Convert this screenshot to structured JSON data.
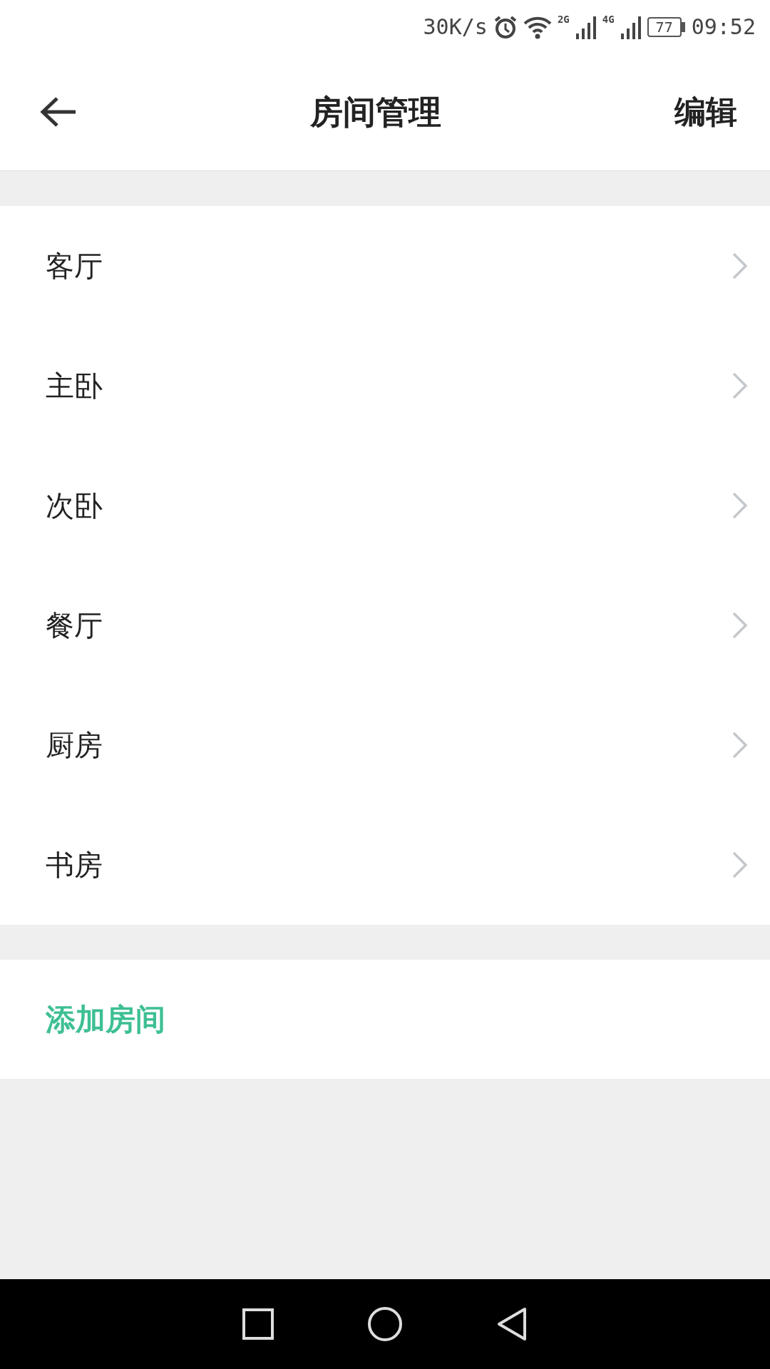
{
  "status_bar": {
    "speed": "30K/s",
    "network_1": "2G",
    "network_2": "4G",
    "battery": "77",
    "time": "09:52"
  },
  "header": {
    "title": "房间管理",
    "action": "编辑"
  },
  "rooms": [
    {
      "name": "客厅"
    },
    {
      "name": "主卧"
    },
    {
      "name": "次卧"
    },
    {
      "name": "餐厅"
    },
    {
      "name": "厨房"
    },
    {
      "name": "书房"
    }
  ],
  "add_button": "添加房间"
}
